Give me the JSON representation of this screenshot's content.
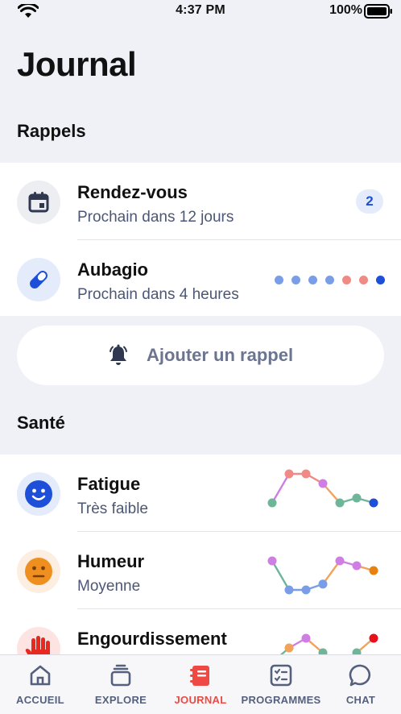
{
  "status": {
    "time": "4:37 PM",
    "battery": "100%"
  },
  "page": {
    "title": "Journal"
  },
  "reminders": {
    "section_title": "Rappels",
    "items": [
      {
        "title": "Rendez-vous",
        "subtitle": "Prochain dans 12  jours",
        "badge": "2",
        "icon": "calendar-icon"
      },
      {
        "title": "Aubagio",
        "subtitle": "Prochain dans 4 heures",
        "icon": "pill-icon",
        "dot_colors": [
          "#7a9de8",
          "#7a9de8",
          "#7a9de8",
          "#7a9de8",
          "#f08a84",
          "#f08a84",
          "#1d4fd8"
        ]
      }
    ],
    "add_label": "Ajouter un rappel",
    "add_icon": "bell-icon"
  },
  "health": {
    "section_title": "Santé",
    "items": [
      {
        "title": "Fatigue",
        "subtitle": "Très faible",
        "icon": "smile-face-icon",
        "trend": [
          2,
          5,
          5,
          4,
          2,
          2.5,
          2
        ]
      },
      {
        "title": "Humeur",
        "subtitle": "Moyenne",
        "icon": "neutral-face-icon",
        "trend": [
          4,
          1,
          1,
          1.6,
          4,
          3.5,
          3
        ]
      },
      {
        "title": "Engourdissement",
        "subtitle": "",
        "icon": "hand-icon",
        "trend": [
          1.5,
          3,
          4,
          2.5,
          1,
          2.5,
          4
        ]
      }
    ]
  },
  "tabs": [
    {
      "label": "ACCUEIL",
      "icon": "home-icon",
      "active": false
    },
    {
      "label": "EXPLORE",
      "icon": "stack-icon",
      "active": false
    },
    {
      "label": "JOURNAL",
      "icon": "journal-icon",
      "active": true
    },
    {
      "label": "PROGRAMMES",
      "icon": "checklist-icon",
      "active": false
    },
    {
      "label": "CHAT",
      "icon": "chat-bubble-icon",
      "active": false
    }
  ],
  "colors": {
    "accent": "#1d4fd8",
    "active_tab": "#ee4a43",
    "muted": "#4b5775"
  }
}
